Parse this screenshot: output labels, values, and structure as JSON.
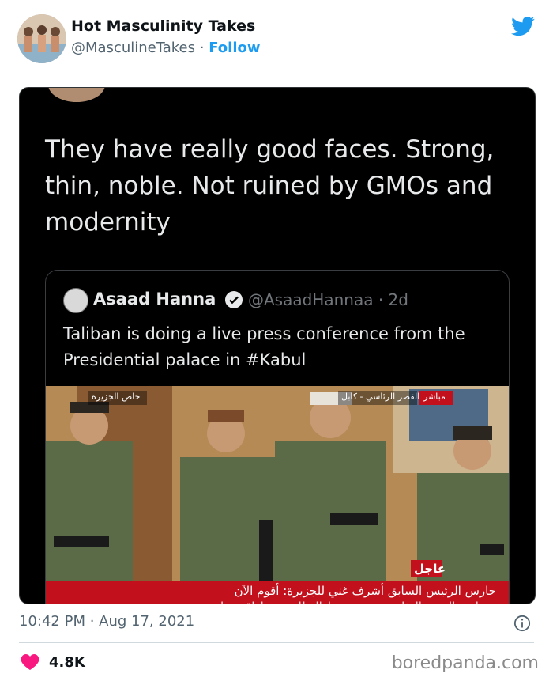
{
  "account": {
    "name": "Hot Masculinity Takes",
    "handle": "@MasculineTakes",
    "separator": "·",
    "follow_label": "Follow",
    "avatar_icon": "profile-avatar-icon"
  },
  "brand_icon": "twitter-bird-icon",
  "brand_color": "#1d9bf0",
  "embedded": {
    "text": "They have really good faces. Strong, thin, noble. Not ruined by GMOs and modernity",
    "quoted": {
      "name": "Asaad Hanna",
      "handle": "@AsaadHannaa",
      "age": "· 2d",
      "text": "Taliban is doing a live press conference from the Presidential palace in #Kabul",
      "media": {
        "badge_left": "خاص الجزيرة",
        "badge_right": "القصر الرئاسي - كابل",
        "badge_live": "مباشر",
        "ticker_label": "عاجل",
        "ticker_line1": "حارس الرئيس السابق أشرف غني للجزيرة: أقوم الآن",
        "ticker_line2": "بحراسة القصر الرئاسي بعد سقوط النظام دون إراقة دماء"
      }
    }
  },
  "timestamp": "10:42 PM · Aug 17, 2021",
  "likes": "4.8K",
  "like_icon": "heart-icon",
  "like_color": "#f91880",
  "info_icon": "info-icon",
  "watermark": "boredpanda.com"
}
